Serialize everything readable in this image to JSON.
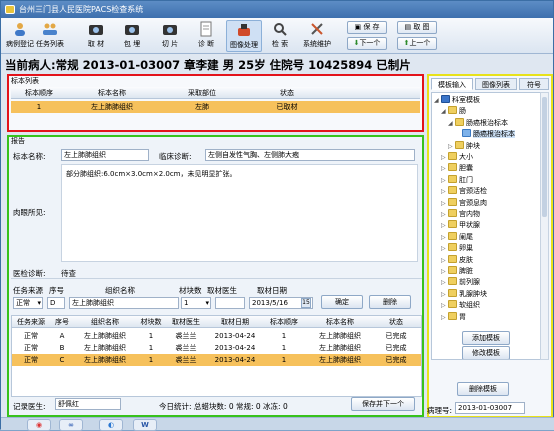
{
  "window": {
    "title": "台州三门县人民医院PACS检查系统"
  },
  "toolbar": {
    "buttons": [
      "病例登记",
      "任务列表",
      "取 材",
      "包 埋",
      "切 片",
      "诊 断",
      "图像处理",
      "检 索",
      "系统维护"
    ],
    "save": "保 存",
    "fetch": "取 图",
    "next": "下一个",
    "prev": "上一个"
  },
  "patient": {
    "header": "当前病人:常规   2013-01-03007  章李建   男   25岁  住院号  10425894  已制片"
  },
  "sample_list": {
    "title": "标本列表",
    "columns": [
      "标本顺序",
      "标本名称",
      "采取部位",
      "状态"
    ],
    "rows": [
      {
        "order": "1",
        "name": "左上肺肺组织",
        "site": "左肺",
        "status": "已取材"
      }
    ]
  },
  "report": {
    "title": "报告",
    "specimen_label": "标本名称:",
    "specimen_value": "左上肺肺组织",
    "diagnosis_label": "临床诊断:",
    "diagnosis_value": "左侧自发性气胸、左侧肺大疱",
    "gross_label": "肉眼所见:",
    "gross_text": "部分肺组织:6.0cm×3.0cm×2.0cm，未见明显扩张。",
    "lab_label": "医检诊断:",
    "lab_value": "待查",
    "form_labels": [
      "任务来源",
      "序号",
      "组织名称",
      "材块数",
      "取材医生",
      "取材日期"
    ],
    "form_values": {
      "source": "正常",
      "seq": "D",
      "tissue": "左上肺肺组织",
      "blocks": "1",
      "doctor": "",
      "date": "2013/5/16"
    },
    "confirm": "确定",
    "delete": "删除"
  },
  "task_table": {
    "columns": [
      "任务来源",
      "序号",
      "组织名称",
      "材块数",
      "取材医生",
      "取材日期",
      "标本顺序",
      "标本名称",
      "状态"
    ],
    "rows": [
      [
        "正常",
        "A",
        "左上肺肺组织",
        "1",
        "裘兰兰",
        "2013-04-24",
        "1",
        "左上肺肺组织",
        "已完成"
      ],
      [
        "正常",
        "B",
        "左上肺肺组织",
        "1",
        "裘兰兰",
        "2013-04-24",
        "1",
        "左上肺肺组织",
        "已完成"
      ],
      [
        "正常",
        "C",
        "左上肺肺组织",
        "1",
        "裘兰兰",
        "2013-04-24",
        "1",
        "左上肺肺组织",
        "已完成"
      ]
    ]
  },
  "footer": {
    "recorder_label": "记录医生:",
    "recorder_value": "舒佩红",
    "stats": "今日统计: 总蜡块数: 0  常规: 0  冰冻: 0",
    "save_next": "保存并下一个"
  },
  "right_panel": {
    "tabs": [
      "模板输入",
      "图像列表",
      "符号"
    ],
    "tree": [
      {
        "label": "科室模板",
        "level": 0
      },
      {
        "label": "肠",
        "level": 1
      },
      {
        "label": "肠癌根治标本",
        "level": 2
      },
      {
        "label": "肠癌根治标本",
        "level": 3
      },
      {
        "label": "肿块",
        "level": 2
      },
      {
        "label": "大小",
        "level": 1
      },
      {
        "label": "胆囊",
        "level": 1
      },
      {
        "label": "肛门",
        "level": 1
      },
      {
        "label": "宫颈活检",
        "level": 1
      },
      {
        "label": "宫颈息肉",
        "level": 1
      },
      {
        "label": "宫内物",
        "level": 1
      },
      {
        "label": "甲状腺",
        "level": 1
      },
      {
        "label": "阑尾",
        "level": 1
      },
      {
        "label": "卵巢",
        "level": 1
      },
      {
        "label": "皮肤",
        "level": 1
      },
      {
        "label": "脾脏",
        "level": 1
      },
      {
        "label": "前列腺",
        "level": 1
      },
      {
        "label": "乳腺肿块",
        "level": 1
      },
      {
        "label": "软组织",
        "level": 1
      },
      {
        "label": "胃",
        "level": 1
      }
    ],
    "add": "添加模板",
    "edit": "修改模板",
    "remove": "删除模板",
    "pathology_label": "病理号:",
    "pathology_value": "2013-01-03007"
  },
  "colors": {
    "red_box": "#e3131b",
    "green_box": "#37c21c",
    "yellow_box": "#e8e21a",
    "selected_row": "#f6c15c"
  }
}
